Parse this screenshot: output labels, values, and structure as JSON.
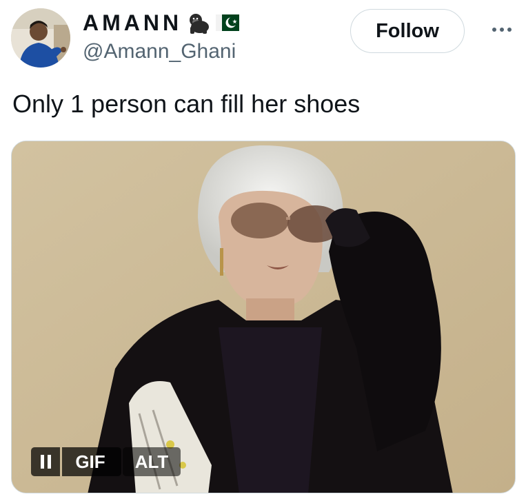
{
  "author": {
    "display_name": "AMANN",
    "name_emojis": [
      "gorilla-emoji",
      "pakistan-flag-emoji"
    ],
    "handle": "@Amann_Ghani",
    "avatar": "profile-photo"
  },
  "actions": {
    "follow_label": "Follow",
    "more_icon": "more-horizontal-icon"
  },
  "tweet": {
    "text": "Only 1 person can fill her shoes"
  },
  "media": {
    "type": "gif",
    "pause_icon": "pause-icon",
    "gif_label": "GIF",
    "alt_label": "ALT"
  },
  "colors": {
    "text_primary": "#0f1419",
    "text_secondary": "#536471",
    "border": "#cfd9de",
    "flag_green": "#01411c",
    "media_background": "#cdbb98"
  }
}
